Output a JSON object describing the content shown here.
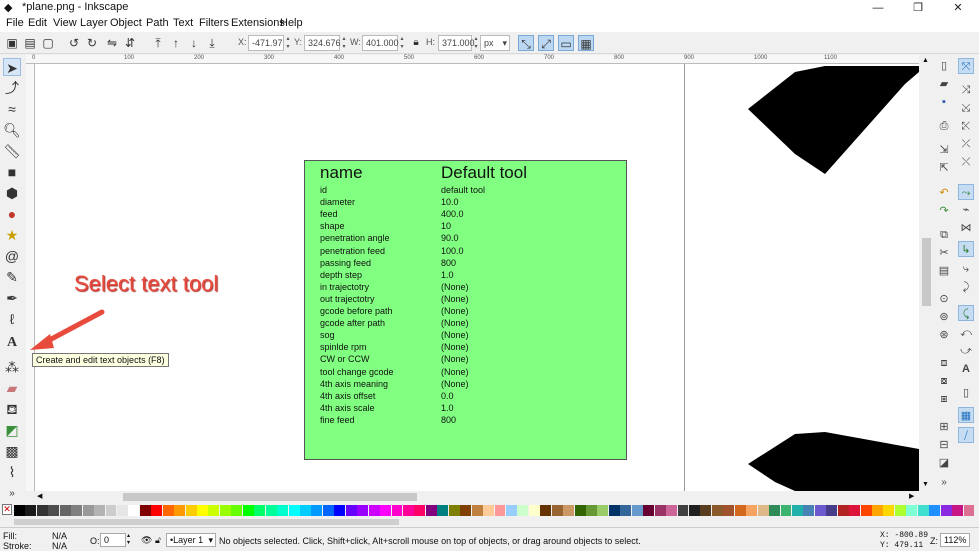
{
  "window": {
    "title": "*plane.png - Inkscape",
    "minimize": "—",
    "maximize": "❐",
    "close": "✕"
  },
  "menu": [
    "File",
    "Edit",
    "View",
    "Layer",
    "Object",
    "Path",
    "Text",
    "Filters",
    "Extensions",
    "Help"
  ],
  "toolbar": {
    "x_label": "X:",
    "x_value": "-471.97",
    "y_label": "Y:",
    "y_value": "324.676",
    "w_label": "W:",
    "w_value": "401.000",
    "h_label": "H:",
    "h_value": "371.000",
    "unit": "px"
  },
  "ruler_marks": [
    "0",
    "100",
    "200",
    "300",
    "400",
    "500",
    "600",
    "700",
    "800",
    "900",
    "1000",
    "1100"
  ],
  "annotation": {
    "text": "Select text tool",
    "color": "#e84a3b"
  },
  "tooltip": "Create and edit text objects (F8)",
  "table": {
    "header": {
      "name": "name",
      "value": "Default tool"
    },
    "rows": [
      [
        "id",
        "default tool"
      ],
      [
        "diameter",
        "10.0"
      ],
      [
        "feed",
        "400.0"
      ],
      [
        "shape",
        "10"
      ],
      [
        "penetration angle",
        "90.0"
      ],
      [
        "penetration feed",
        "100.0"
      ],
      [
        "passing feed",
        "800"
      ],
      [
        "depth step",
        "1.0"
      ],
      [
        "in trajectotry",
        "(None)"
      ],
      [
        "out trajectotry",
        "(None)"
      ],
      [
        "gcode before path",
        "(None)"
      ],
      [
        "gcode after path",
        "(None)"
      ],
      [
        "sog",
        "(None)"
      ],
      [
        "spinlde rpm",
        "(None)"
      ],
      [
        "CW or CCW",
        "(None)"
      ],
      [
        "tool change gcode",
        "(None)"
      ],
      [
        "4th axis meaning",
        "(None)"
      ],
      [
        "4th axis offset",
        "0.0"
      ],
      [
        "4th axis scale",
        "1.0"
      ],
      [
        "fine feed",
        "800"
      ]
    ],
    "background": "#80ff80"
  },
  "status": {
    "fill_label": "Fill:",
    "fill_value": "N/A",
    "stroke_label": "Stroke:",
    "stroke_value": "N/A",
    "opacity_label": "O:",
    "opacity_value": "0",
    "layer": "•Layer 1",
    "message": "No objects selected. Click, Shift+click, Alt+scroll mouse on top of objects, or drag around objects to select.",
    "coord_x": "X: -800.89",
    "coord_y": "Y:   479.11",
    "zoom_label": "Z:",
    "zoom_value": "112%"
  },
  "palette_colors": [
    "#000000",
    "#1a1a1a",
    "#333333",
    "#4d4d4d",
    "#666666",
    "#808080",
    "#999999",
    "#b3b3b3",
    "#cccccc",
    "#e6e6e6",
    "#ffffff",
    "#800000",
    "#ff0000",
    "#ff6600",
    "#ff9900",
    "#ffcc00",
    "#ffff00",
    "#ccff00",
    "#99ff00",
    "#66ff00",
    "#00ff00",
    "#00ff66",
    "#00ff99",
    "#00ffcc",
    "#00ffff",
    "#00ccff",
    "#0099ff",
    "#0066ff",
    "#0000ff",
    "#6600ff",
    "#9900ff",
    "#cc00ff",
    "#ff00ff",
    "#ff00cc",
    "#ff0099",
    "#ff0066",
    "#800080",
    "#008080",
    "#808000",
    "#804000",
    "#c08040",
    "#ffcc99",
    "#ff9999",
    "#99ccff",
    "#ccffcc",
    "#ffffcc",
    "#663300",
    "#996633",
    "#cc9966",
    "#336600",
    "#669933",
    "#99cc66",
    "#003366",
    "#336699",
    "#6699cc",
    "#660033",
    "#993366",
    "#cc6699",
    "#404040",
    "#202020",
    "#5a3c1e",
    "#8b5a2b",
    "#a0522d",
    "#d2691e",
    "#f4a460",
    "#deb887",
    "#2e8b57",
    "#3cb371",
    "#20b2aa",
    "#4682b4",
    "#6a5acd",
    "#483d8b",
    "#b22222",
    "#dc143c",
    "#ff4500",
    "#ffa500",
    "#ffd700",
    "#adff2f",
    "#7fffd4",
    "#40e0d0",
    "#1e90ff",
    "#8a2be2",
    "#c71585",
    "#db7093"
  ]
}
